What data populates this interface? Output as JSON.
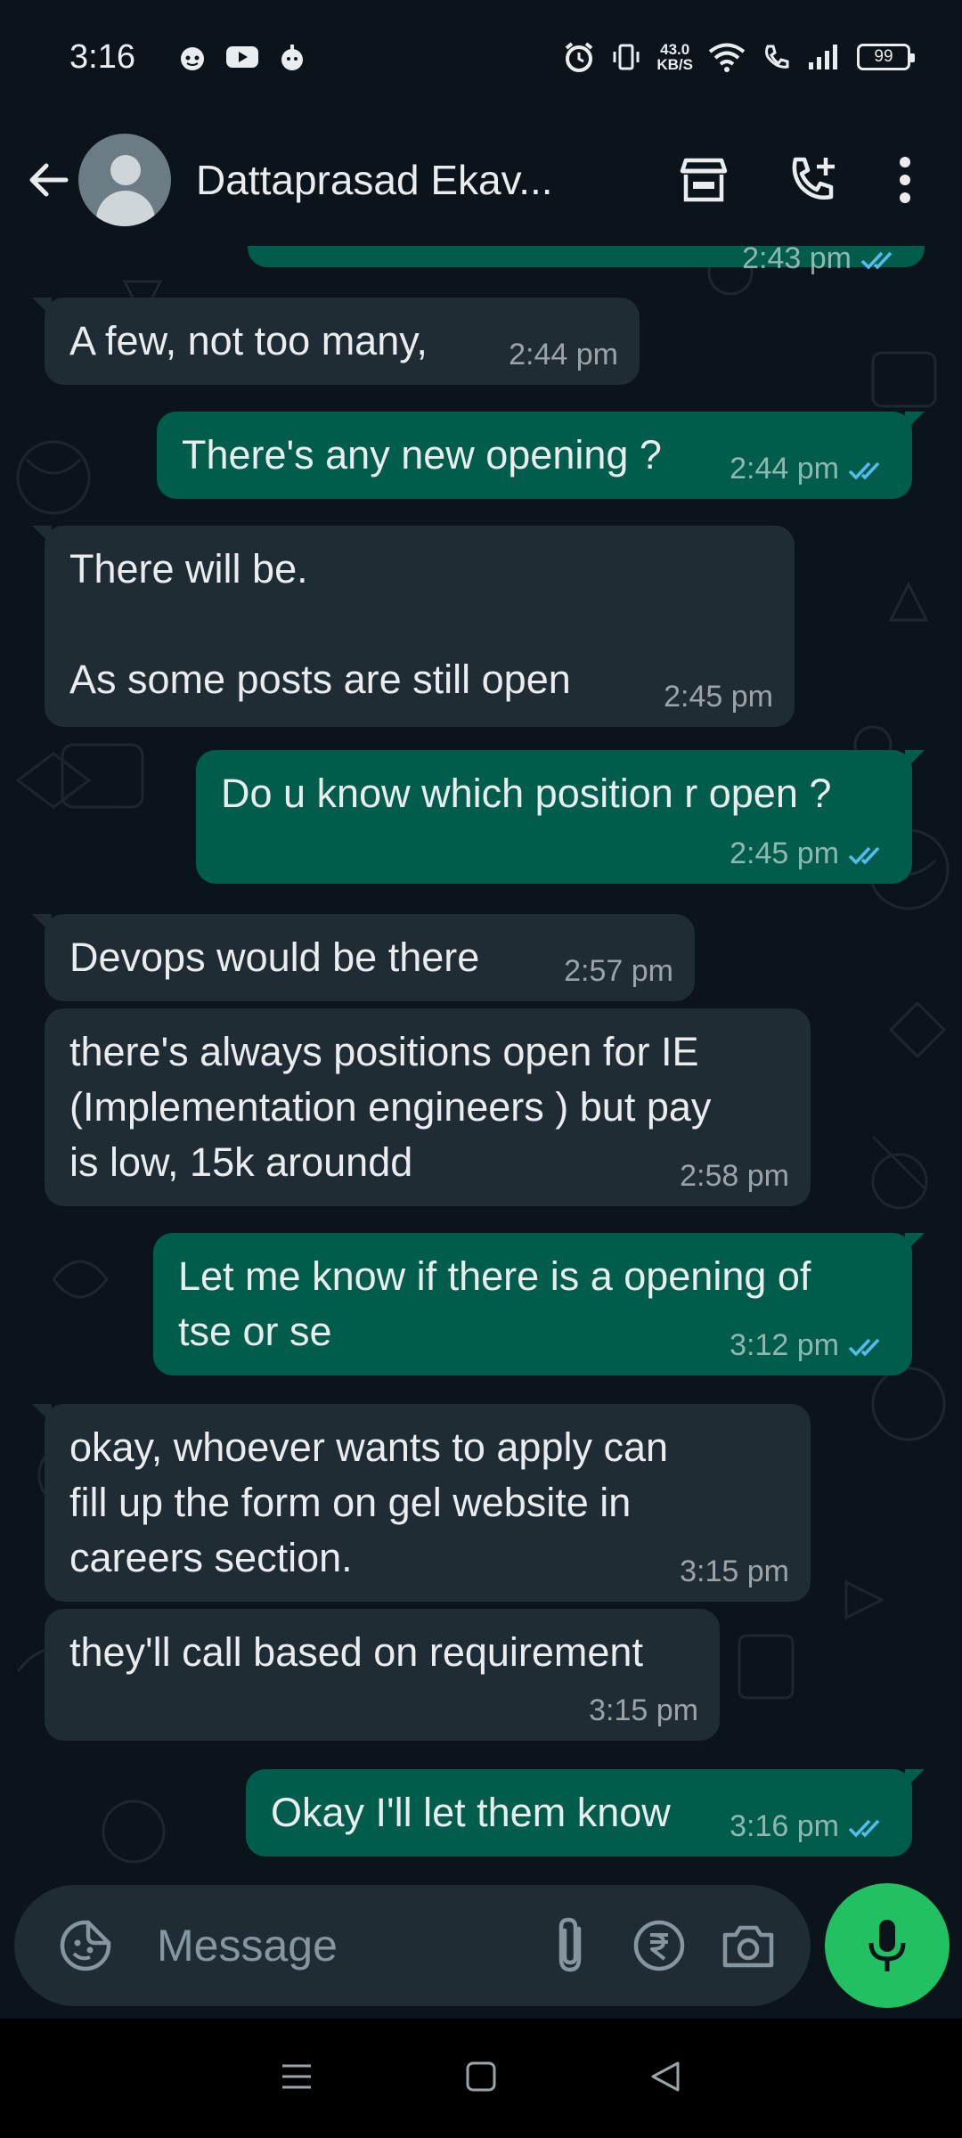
{
  "status_bar": {
    "time": "3:16",
    "net_speed_value": "43.0",
    "net_speed_unit": "KB/S",
    "battery": "99"
  },
  "header": {
    "contact_name": "Dattaprasad Ekav...",
    "icons": [
      "back-arrow-icon",
      "avatar",
      "shop-icon",
      "add-call-icon",
      "more-vert-icon"
    ]
  },
  "messages": [
    {
      "dir": "out",
      "text": "",
      "time": "2:43 pm",
      "read": true,
      "partial": true
    },
    {
      "dir": "in",
      "text": "A few, not too many,",
      "time": "2:44 pm"
    },
    {
      "dir": "out",
      "text": "There's any new opening ?",
      "time": "2:44 pm",
      "read": true
    },
    {
      "dir": "in",
      "text": "There will be.\n\nAs some posts are still open",
      "time": "2:45 pm"
    },
    {
      "dir": "out",
      "text": "Do u know which position r open ?",
      "time": "2:45 pm",
      "read": true
    },
    {
      "dir": "in",
      "text": "Devops would be there",
      "time": "2:57 pm"
    },
    {
      "dir": "in",
      "text": "there's always positions open for IE\n(Implementation engineers ) but pay\nis low, 15k aroundd",
      "time": "2:58 pm"
    },
    {
      "dir": "out",
      "text": "Let me know if there is a opening of\ntse or se",
      "time": "3:12 pm",
      "read": true
    },
    {
      "dir": "in",
      "text": "okay, whoever wants to apply can\nfill up the form on gel website in\ncareers section.",
      "time": "3:15 pm"
    },
    {
      "dir": "in",
      "text": "they'll call based on requirement",
      "time": "3:15 pm"
    },
    {
      "dir": "out",
      "text": "Okay I'll let them know",
      "time": "3:16 pm",
      "read": true
    }
  ],
  "composer": {
    "placeholder": "Message"
  },
  "colors": {
    "background": "#0b141a",
    "incoming_bubble": "#1f2c34",
    "outgoing_bubble": "#005c4b",
    "read_ticks": "#53bdeb",
    "mic_button": "#21c063"
  }
}
